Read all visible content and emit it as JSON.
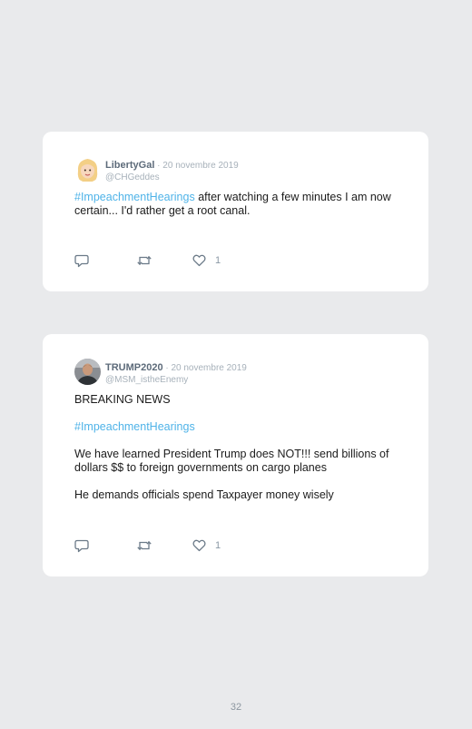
{
  "tweets": [
    {
      "name": "LibertyGal",
      "separator": " · ",
      "date": "20 novembre 2019",
      "handle": "@CHGeddes",
      "hashtag": "#ImpeachmentHearings",
      "text": " after watching a few minutes I am now certain... I'd rather get a root canal.",
      "reply_icon": "comment-icon",
      "retweet_icon": "retweet-icon",
      "like_icon": "heart-icon",
      "likes": "1"
    },
    {
      "name": "TRUMP2020",
      "separator": " · ",
      "date": "20 novembre 2019",
      "handle": "@MSM_istheEnemy",
      "paragraph1": "BREAKING NEWS",
      "hashtag": "#ImpeachmentHearings",
      "paragraph3": "We have learned President Trump does NOT!!! send billions of dollars $$ to foreign governments on cargo planes",
      "paragraph4": "He demands officials spend Taxpayer money wisely",
      "reply_icon": "comment-icon",
      "retweet_icon": "retweet-icon",
      "like_icon": "heart-icon",
      "likes": "1"
    }
  ],
  "page_number": "32",
  "colors": {
    "background": "#e9eaec",
    "card": "#ffffff",
    "hashtag": "#4fb3e8",
    "name": "#5d6b7a",
    "muted": "#a7b1ba"
  }
}
